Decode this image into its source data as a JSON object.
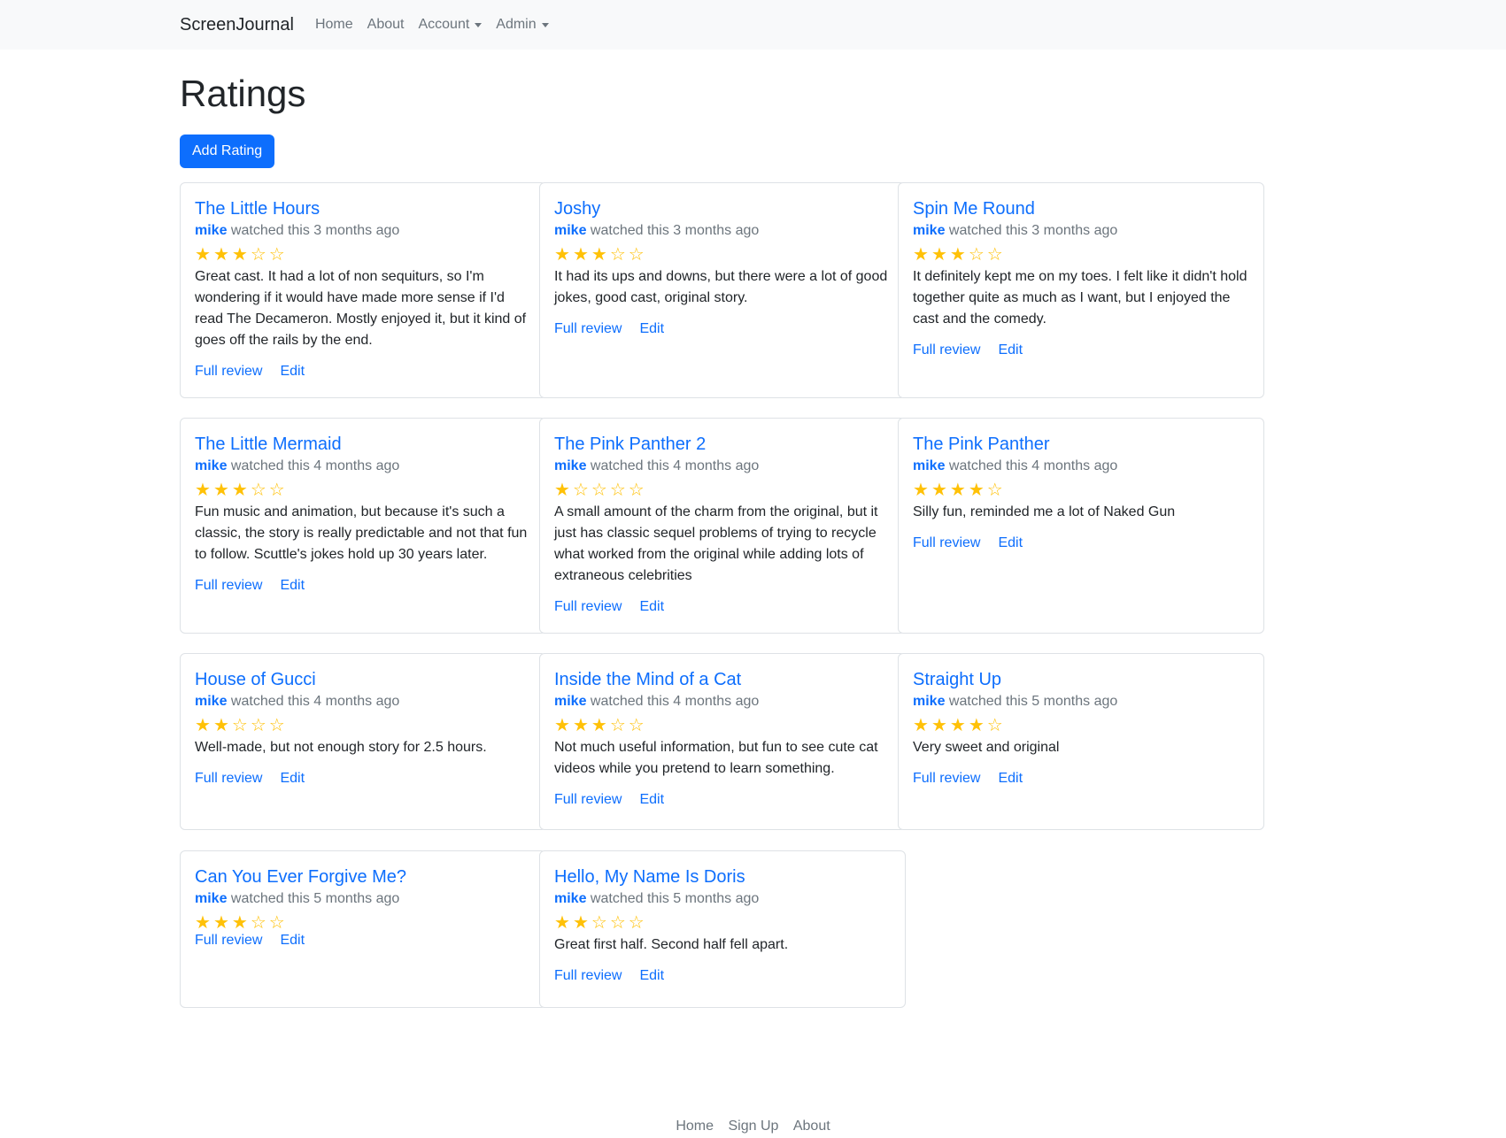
{
  "navbar": {
    "brand": "ScreenJournal",
    "links": [
      "Home",
      "About"
    ],
    "dropdowns": [
      "Account",
      "Admin"
    ]
  },
  "page": {
    "title": "Ratings",
    "add_button": "Add Rating"
  },
  "card_links": {
    "full_review": "Full review",
    "edit": "Edit"
  },
  "ratings": [
    {
      "title": "The Little Hours",
      "user": "mike",
      "watched": "watched this 3 months ago",
      "stars": 3,
      "review": "Great cast. It had a lot of non sequiturs, so I'm wondering if it would have made more sense if I'd read The Decameron. Mostly enjoyed it, but it kind of goes off the rails by the end."
    },
    {
      "title": "Joshy",
      "user": "mike",
      "watched": "watched this 3 months ago",
      "stars": 3,
      "review": "It had its ups and downs, but there were a lot of good jokes, good cast, original story."
    },
    {
      "title": "Spin Me Round",
      "user": "mike",
      "watched": "watched this 3 months ago",
      "stars": 3,
      "review": "It definitely kept me on my toes. I felt like it didn't hold together quite as much as I want, but I enjoyed the cast and the comedy."
    },
    {
      "title": "The Little Mermaid",
      "user": "mike",
      "watched": "watched this 4 months ago",
      "stars": 3,
      "review": "Fun music and animation, but because it's such a classic, the story is really predictable and not that fun to follow. Scuttle's jokes hold up 30 years later."
    },
    {
      "title": "The Pink Panther 2",
      "user": "mike",
      "watched": "watched this 4 months ago",
      "stars": 1,
      "review": "A small amount of the charm from the original, but it just has classic sequel problems of trying to recycle what worked from the original while adding lots of extraneous celebrities"
    },
    {
      "title": "The Pink Panther",
      "user": "mike",
      "watched": "watched this 4 months ago",
      "stars": 4,
      "review": "Silly fun, reminded me a lot of Naked Gun"
    },
    {
      "title": "House of Gucci",
      "user": "mike",
      "watched": "watched this 4 months ago",
      "stars": 2,
      "review": "Well-made, but not enough story for 2.5 hours."
    },
    {
      "title": "Inside the Mind of a Cat",
      "user": "mike",
      "watched": "watched this 4 months ago",
      "stars": 3,
      "review": "Not much useful information, but fun to see cute cat videos while you pretend to learn something."
    },
    {
      "title": "Straight Up",
      "user": "mike",
      "watched": "watched this 5 months ago",
      "stars": 4,
      "review": "Very sweet and original"
    },
    {
      "title": "Can You Ever Forgive Me?",
      "user": "mike",
      "watched": "watched this 5 months ago",
      "stars": 3,
      "review": ""
    },
    {
      "title": "Hello, My Name Is Doris",
      "user": "mike",
      "watched": "watched this 5 months ago",
      "stars": 2,
      "review": "Great first half. Second half fell apart."
    }
  ],
  "footer": {
    "links": [
      "Home",
      "Sign Up",
      "About"
    ]
  },
  "colors": {
    "link": "#0d6efd",
    "star": "#ffc107",
    "muted": "#6c757d",
    "navbar_bg": "#f8f9fa"
  }
}
